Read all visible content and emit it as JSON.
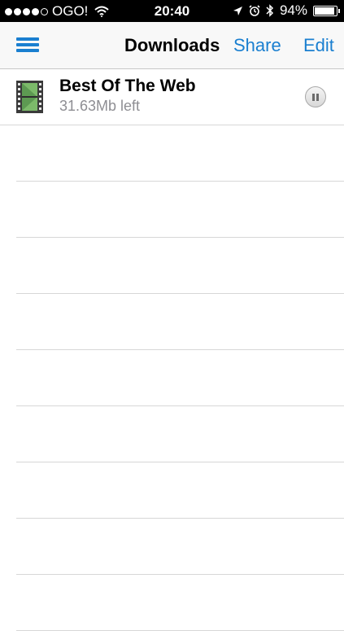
{
  "status_bar": {
    "carrier": "OGO!",
    "time": "20:40",
    "battery": "94%",
    "signal_bars": 4,
    "battery_level": 0.94
  },
  "nav": {
    "title": "Downloads",
    "share_label": "Share",
    "edit_label": "Edit",
    "accent_color": "#1a7fd0"
  },
  "downloads": [
    {
      "title": "Best Of The Web",
      "status": "31.63Mb left",
      "icon": "film-icon",
      "action_icon": "pause-icon"
    }
  ],
  "colors": {
    "status_bar_bg": "#000000",
    "nav_bg": "#f8f8f8",
    "subtitle_text": "#8e8e93"
  }
}
